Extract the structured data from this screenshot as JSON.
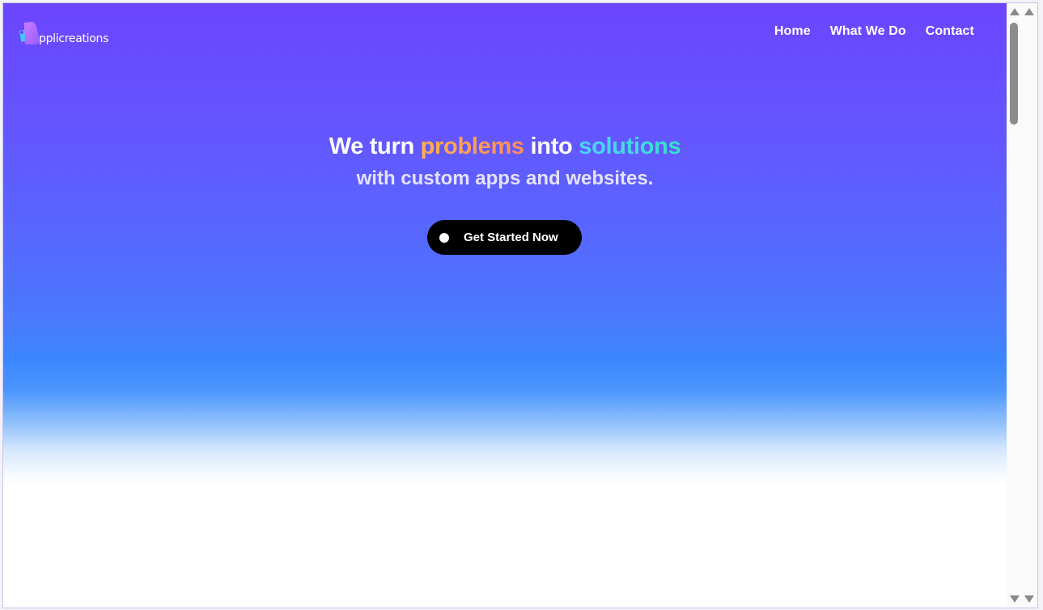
{
  "header": {
    "logo_text": "pplicreations",
    "nav": [
      {
        "label": "Home"
      },
      {
        "label": "What We Do"
      },
      {
        "label": "Contact"
      }
    ]
  },
  "hero": {
    "title_part1": "We turn ",
    "title_highlight1": "problems",
    "title_part2": " into ",
    "title_highlight2": "solutions",
    "subtitle": "with custom apps and websites.",
    "cta_label": "Get Started Now"
  },
  "colors": {
    "gradient_top": "#6b45ff",
    "gradient_mid": "#3b86ff",
    "problems_accent": "#ffa85a",
    "solutions_accent": "#40d8e0",
    "cta_background": "#000000"
  },
  "icons": {
    "logo": "applicreations-logo-icon",
    "cta": "dot-icon",
    "scroll_up": "arrow-up-icon",
    "scroll_down": "arrow-down-icon"
  }
}
